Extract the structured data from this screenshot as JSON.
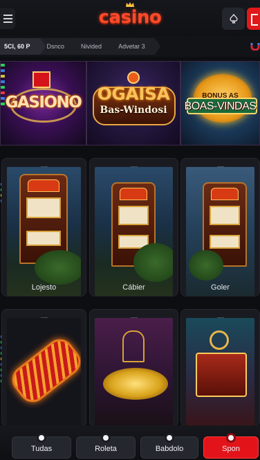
{
  "header": {
    "logo_text": "casino",
    "menu_icon": "hamburger-icon",
    "user_icon": "spade-icon",
    "login_icon": "login-icon",
    "accent": "#e01a1a"
  },
  "breadcrumb": {
    "items": [
      "5CI, 60 P",
      "Dsnco",
      "Nivided",
      "Advetar 3"
    ]
  },
  "banners": [
    {
      "title": "GASIONO"
    },
    {
      "title": "OGAISA",
      "subtitle": "Bas-Windosi"
    },
    {
      "title": "BOAS-VINDAS",
      "small": "BONUS AS"
    }
  ],
  "games": [
    {
      "label": "Lojesto"
    },
    {
      "label": "Cábier"
    },
    {
      "label": "Goler"
    },
    {
      "label": ""
    },
    {
      "label": ""
    },
    {
      "label": ""
    }
  ],
  "bottom_nav": [
    {
      "label": "Tudas"
    },
    {
      "label": "Roleta"
    },
    {
      "label": "Babdolo"
    },
    {
      "label": "Spon"
    }
  ]
}
